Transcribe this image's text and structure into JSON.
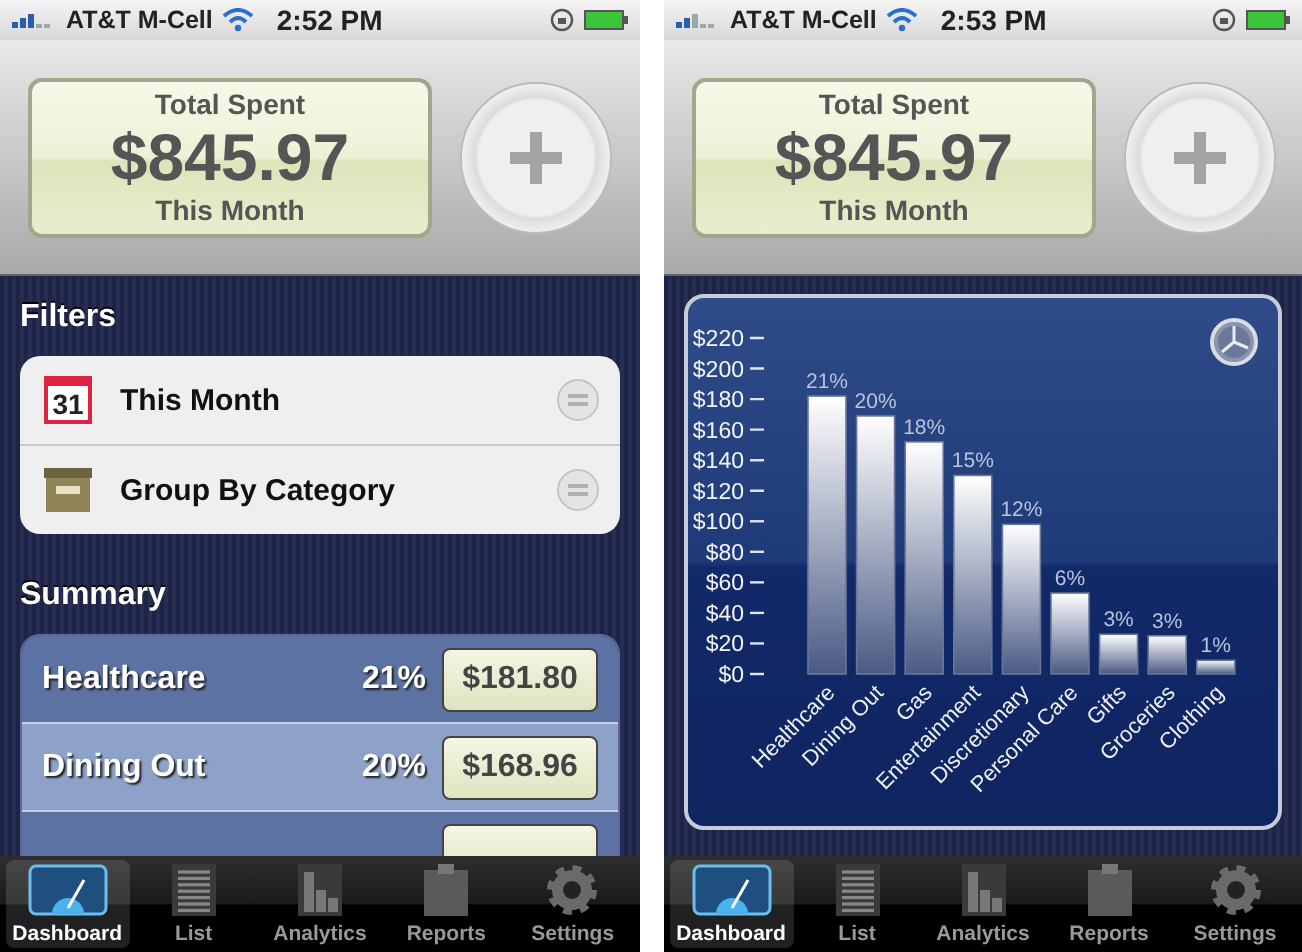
{
  "screens": [
    {
      "kind": "dashboard",
      "status_bar": {
        "carrier": "AT&T M-Cell",
        "time": "2:52 PM"
      },
      "header": {
        "label": "Total Spent",
        "amount": "$845.97",
        "period": "This Month"
      },
      "filters": {
        "title": "Filters",
        "items": [
          {
            "kind": "calendar",
            "badge": "31",
            "label": "This Month"
          },
          {
            "kind": "drawer",
            "label": "Group By Category"
          }
        ]
      },
      "summary": {
        "title": "Summary",
        "rows": [
          {
            "category": "Healthcare",
            "percent": "21%",
            "amount": "$181.80"
          },
          {
            "category": "Dining Out",
            "percent": "20%",
            "amount": "$168.96"
          }
        ]
      },
      "tab_bar": [
        {
          "label": "Dashboard",
          "selected": true
        },
        {
          "label": "List",
          "selected": false
        },
        {
          "label": "Analytics",
          "selected": false
        },
        {
          "label": "Reports",
          "selected": false
        },
        {
          "label": "Settings",
          "selected": false
        }
      ]
    },
    {
      "kind": "chart",
      "status_bar": {
        "carrier": "AT&T M-Cell",
        "time": "2:53 PM"
      },
      "header": {
        "label": "Total Spent",
        "amount": "$845.97",
        "period": "This Month"
      },
      "chart_panel": {
        "chart_data": {
          "type": "bar",
          "categories": [
            "Healthcare",
            "Dining Out",
            "Gas",
            "Entertainment",
            "Discretionary",
            "Personal Care",
            "Gifts",
            "Groceries",
            "Clothing"
          ],
          "values": [
            182,
            169,
            152,
            130,
            98,
            53,
            26,
            25,
            9
          ],
          "ylim": [
            0,
            220
          ],
          "yticks": [
            {
              "value": 0,
              "label": "$0"
            },
            {
              "value": 20,
              "label": "$20"
            },
            {
              "value": 40,
              "label": "$40"
            },
            {
              "value": 60,
              "label": "$60"
            },
            {
              "value": 80,
              "label": "$80"
            },
            {
              "value": 100,
              "label": "$100"
            },
            {
              "value": 120,
              "label": "$120"
            },
            {
              "value": 140,
              "label": "$140"
            },
            {
              "value": 160,
              "label": "$160"
            },
            {
              "value": 180,
              "label": "$180"
            },
            {
              "value": 200,
              "label": "$200"
            },
            {
              "value": 220,
              "label": "$220"
            }
          ],
          "annotations": [
            "21%",
            "20%",
            "18%",
            "15%",
            "12%",
            "6%",
            "3%",
            "3%",
            "1%"
          ]
        }
      },
      "tab_bar": [
        {
          "label": "Dashboard",
          "selected": true
        },
        {
          "label": "List",
          "selected": false
        },
        {
          "label": "Analytics",
          "selected": false
        },
        {
          "label": "Reports",
          "selected": false
        },
        {
          "label": "Settings",
          "selected": false
        }
      ]
    }
  ]
}
